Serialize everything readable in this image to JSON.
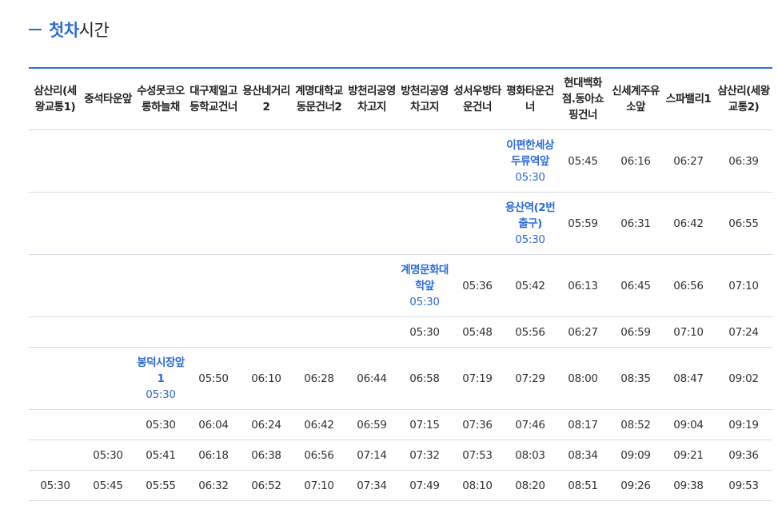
{
  "page": {
    "title_highlight": "첫차",
    "title_rest": "시간"
  },
  "columns": [
    "삼산리(세왕교통1)",
    "중석타운앞",
    "수성못코오롱하늘채",
    "대구제일고등학교건너",
    "용산네거리2",
    "계명대학교동문건너2",
    "방천리공영차고지",
    "방천리공영차고지",
    "성서우방타운건너",
    "평화타운건너",
    "현대백화점.동아쇼핑건너",
    "신세계주유소앞",
    "스파밸리1",
    "삼산리(세왕교통2)"
  ],
  "rows": [
    {
      "origin": {
        "col": 9,
        "stop": "이편한세상두류역앞",
        "time": "05:30"
      },
      "times": [
        "",
        "",
        "",
        "",
        "",
        "",
        "",
        "",
        "",
        "",
        "05:45",
        "06:16",
        "06:27",
        "06:39"
      ]
    },
    {
      "origin": {
        "col": 9,
        "stop": "용산역(2번출구)",
        "time": "05:30"
      },
      "times": [
        "",
        "",
        "",
        "",
        "",
        "",
        "",
        "",
        "",
        "",
        "05:59",
        "06:31",
        "06:42",
        "06:55"
      ]
    },
    {
      "origin": {
        "col": 7,
        "stop": "계명문화대학앞",
        "time": "05:30"
      },
      "times": [
        "",
        "",
        "",
        "",
        "",
        "",
        "",
        "",
        "05:36",
        "05:42",
        "06:13",
        "06:45",
        "06:56",
        "07:10"
      ]
    },
    {
      "origin": null,
      "times": [
        "",
        "",
        "",
        "",
        "",
        "",
        "",
        "05:30",
        "05:48",
        "05:56",
        "06:27",
        "06:59",
        "07:10",
        "07:24"
      ]
    },
    {
      "origin": {
        "col": 2,
        "stop": "봉덕시장앞1",
        "time": "05:30"
      },
      "times": [
        "",
        "",
        "",
        "05:50",
        "06:10",
        "06:28",
        "06:44",
        "06:58",
        "07:19",
        "07:29",
        "08:00",
        "08:35",
        "08:47",
        "09:02"
      ]
    },
    {
      "origin": null,
      "times": [
        "",
        "",
        "05:30",
        "06:04",
        "06:24",
        "06:42",
        "06:59",
        "07:15",
        "07:36",
        "07:46",
        "08:17",
        "08:52",
        "09:04",
        "09:19"
      ]
    },
    {
      "origin": null,
      "times": [
        "",
        "05:30",
        "05:41",
        "06:18",
        "06:38",
        "06:56",
        "07:14",
        "07:32",
        "07:53",
        "08:03",
        "08:34",
        "09:09",
        "09:21",
        "09:36"
      ]
    },
    {
      "origin": null,
      "times": [
        "05:30",
        "05:45",
        "05:55",
        "06:32",
        "06:52",
        "07:10",
        "07:34",
        "07:49",
        "08:10",
        "08:20",
        "08:51",
        "09:26",
        "09:38",
        "09:53"
      ]
    }
  ]
}
